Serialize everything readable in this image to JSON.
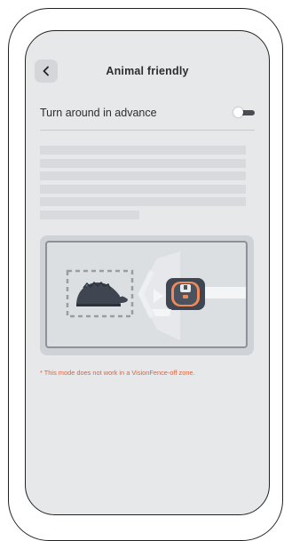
{
  "header": {
    "title": "Animal friendly",
    "back_icon": "chevron-left-icon"
  },
  "setting": {
    "label": "Turn around in advance",
    "toggle_state": "off"
  },
  "note": "* This mode does not work in a VisionFence-off zone.",
  "colors": {
    "background": "#e7e8ea",
    "note": "#e0623c",
    "robot_accent": "#f08a5d"
  }
}
